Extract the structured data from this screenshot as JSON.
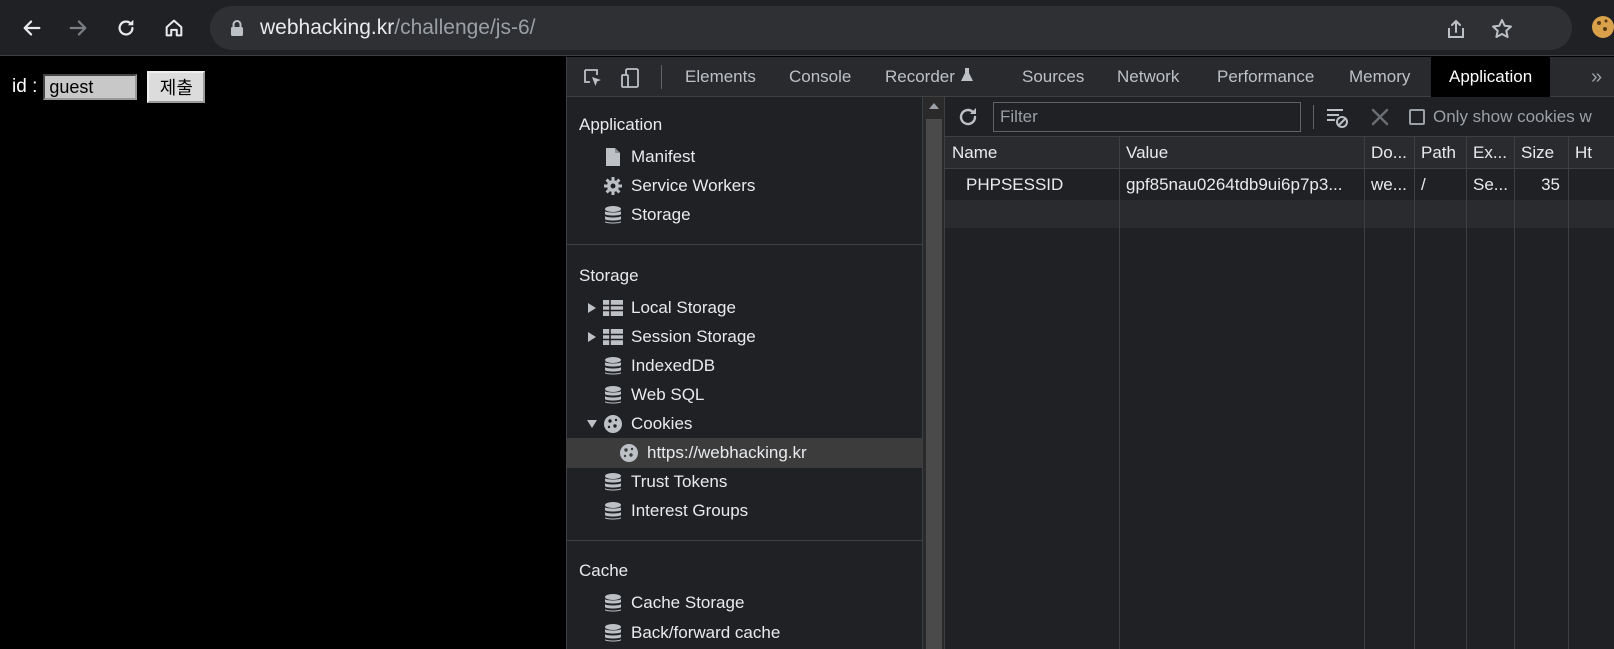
{
  "browser": {
    "url_host": "webhacking.kr",
    "url_path": "/challenge/js-6/"
  },
  "page": {
    "id_label": "id :",
    "id_value": "guest",
    "submit_label": "제출"
  },
  "devtools": {
    "tabs": [
      "Elements",
      "Console",
      "Recorder",
      "Sources",
      "Network",
      "Performance",
      "Memory",
      "Application"
    ],
    "active_tab": "Application",
    "more": "»",
    "sidebar": {
      "application_title": "Application",
      "application_items": [
        "Manifest",
        "Service Workers",
        "Storage"
      ],
      "storage_title": "Storage",
      "storage_items": [
        "Local Storage",
        "Session Storage",
        "IndexedDB",
        "Web SQL",
        "Cookies",
        "https://webhacking.kr",
        "Trust Tokens",
        "Interest Groups"
      ],
      "cache_title": "Cache",
      "cache_items": [
        "Cache Storage",
        "Back/forward cache"
      ]
    },
    "cookies": {
      "filter_placeholder": "Filter",
      "only_show_label": "Only show cookies w",
      "columns": [
        "Name",
        "Value",
        "Do...",
        "Path",
        "Ex...",
        "Size",
        "Ht"
      ],
      "rows": [
        [
          "PHPSESSID",
          "gpf85nau0264tdb9ui6p7p3...",
          "we...",
          "/",
          "Se...",
          "35",
          ""
        ]
      ]
    }
  }
}
